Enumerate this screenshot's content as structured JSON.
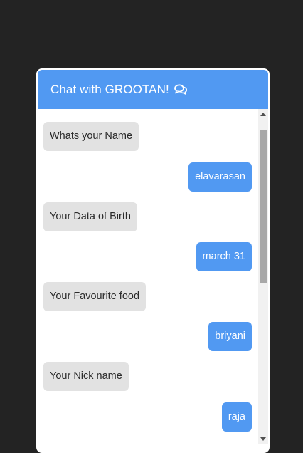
{
  "header": {
    "title": "Chat with GROOTAN!",
    "icon": "comments-icon"
  },
  "messages": [
    {
      "sender": "bot",
      "text": "Whats your Name"
    },
    {
      "sender": "user",
      "text": "elavarasan"
    },
    {
      "sender": "bot",
      "text": "Your Data of Birth"
    },
    {
      "sender": "user",
      "text": "march 31"
    },
    {
      "sender": "bot",
      "text": "Your Favourite food"
    },
    {
      "sender": "user",
      "text": "briyani"
    },
    {
      "sender": "bot",
      "text": "Your Nick name"
    },
    {
      "sender": "user",
      "text": "raja"
    }
  ],
  "colors": {
    "background": "#232323",
    "accent": "#5199f2",
    "bot_bubble": "#e2e2e2",
    "scroll_thumb": "#a8a8a8"
  }
}
